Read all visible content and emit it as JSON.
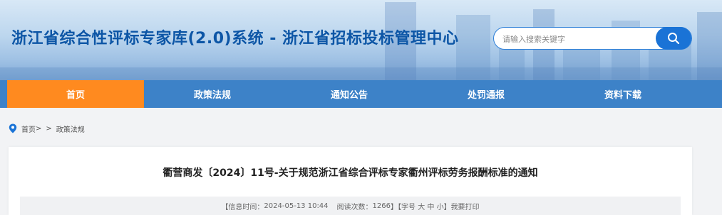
{
  "header": {
    "site_title": "浙江省综合性评标专家库(2.0)系统 - 浙江省招标投标管理中心"
  },
  "search": {
    "placeholder": "请输入搜索关键字",
    "icon": "search-icon"
  },
  "nav": {
    "items": [
      {
        "label": "首页",
        "active": true
      },
      {
        "label": "政策法规",
        "active": false
      },
      {
        "label": "通知公告",
        "active": false
      },
      {
        "label": "处罚通报",
        "active": false
      },
      {
        "label": "资料下载",
        "active": false
      }
    ]
  },
  "breadcrumb": {
    "icon": "location-pin-icon",
    "home": "首页",
    "sep1": ">",
    "sep2": ">",
    "current": "政策法规"
  },
  "article": {
    "title": "衢营商发〔2024〕11号-关于规范浙江省综合评标专家衢州评标劳务报酬标准的通知",
    "meta": {
      "time_prefix": "【信息时间：",
      "time": "2024-05-13 10:44",
      "views_prefix": "阅读次数：",
      "views": "1266",
      "views_suffix": "】【字号",
      "font_large": "大",
      "font_medium": "中",
      "font_small": "小",
      "print_prefix": "】",
      "print": "我要打印"
    }
  },
  "colors": {
    "title_blue": "#0d56a6",
    "nav_blue": "#3d82c8",
    "nav_active": "#ff8a1f",
    "search_blue": "#1a73d6"
  }
}
